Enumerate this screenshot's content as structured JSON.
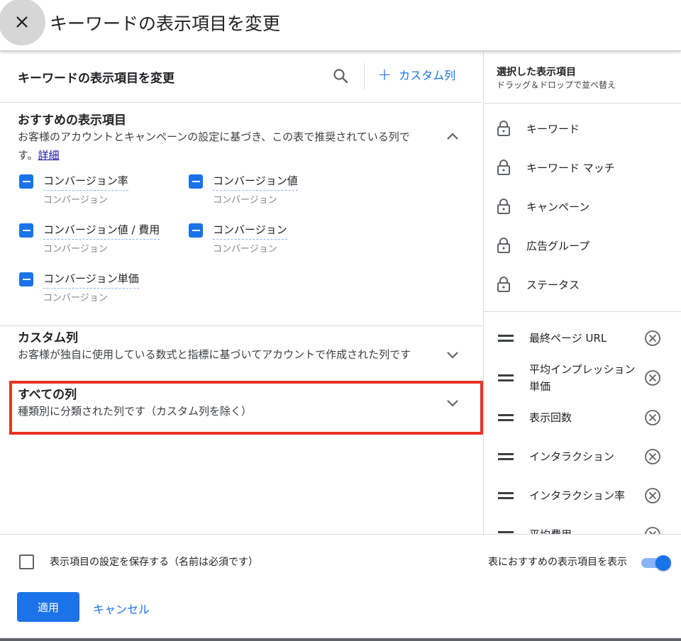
{
  "dialog": {
    "title": "キーワードの表示項目を変更"
  },
  "left_panel": {
    "header_title": "キーワードの表示項目を変更",
    "custom_column_button": "カスタム列",
    "recommended": {
      "title": "おすすめの表示項目",
      "description": "お客様のアカウントとキャンペーンの設定に基づき、この表で推奨されている列です。",
      "details_link": "詳細",
      "items": [
        {
          "label": "コンバージョン率",
          "category": "コンバージョン"
        },
        {
          "label": "コンバージョン値",
          "category": "コンバージョン"
        },
        {
          "label": "コンバージョン値 / 費用",
          "category": "コンバージョン"
        },
        {
          "label": "コンバージョン",
          "category": "コンバージョン"
        },
        {
          "label": "コンバージョン単価",
          "category": "コンバージョン"
        }
      ]
    },
    "custom_columns": {
      "title": "カスタム列",
      "description": "お客様が独自に使用している数式と指標に基づいてアカウントで作成された列です"
    },
    "all_columns": {
      "title": "すべての列",
      "description": "種類別に分類された列です（カスタム列を除く）"
    }
  },
  "right_panel": {
    "title": "選択した表示項目",
    "subtitle": "ドラッグ＆ドロップで並べ替え",
    "locked_items": [
      "キーワード",
      "キーワード マッチ",
      "キャンペーン",
      "広告グループ",
      "ステータス"
    ],
    "movable_items": [
      "最終ページ URL",
      "平均インプレッション単価",
      "表示回数",
      "インタラクション",
      "インタラクション率",
      "平均費用"
    ]
  },
  "footer": {
    "save_label": "表示項目の設定を保存する（名前は必須です）",
    "save_checked": false,
    "recommended_toggle_label": "表におすすめの表示項目を表示",
    "recommended_toggle_on": true,
    "apply_label": "適用",
    "cancel_label": "キャンセル"
  },
  "colors": {
    "accent": "#1a73e8",
    "highlight_border": "#ea3323"
  }
}
